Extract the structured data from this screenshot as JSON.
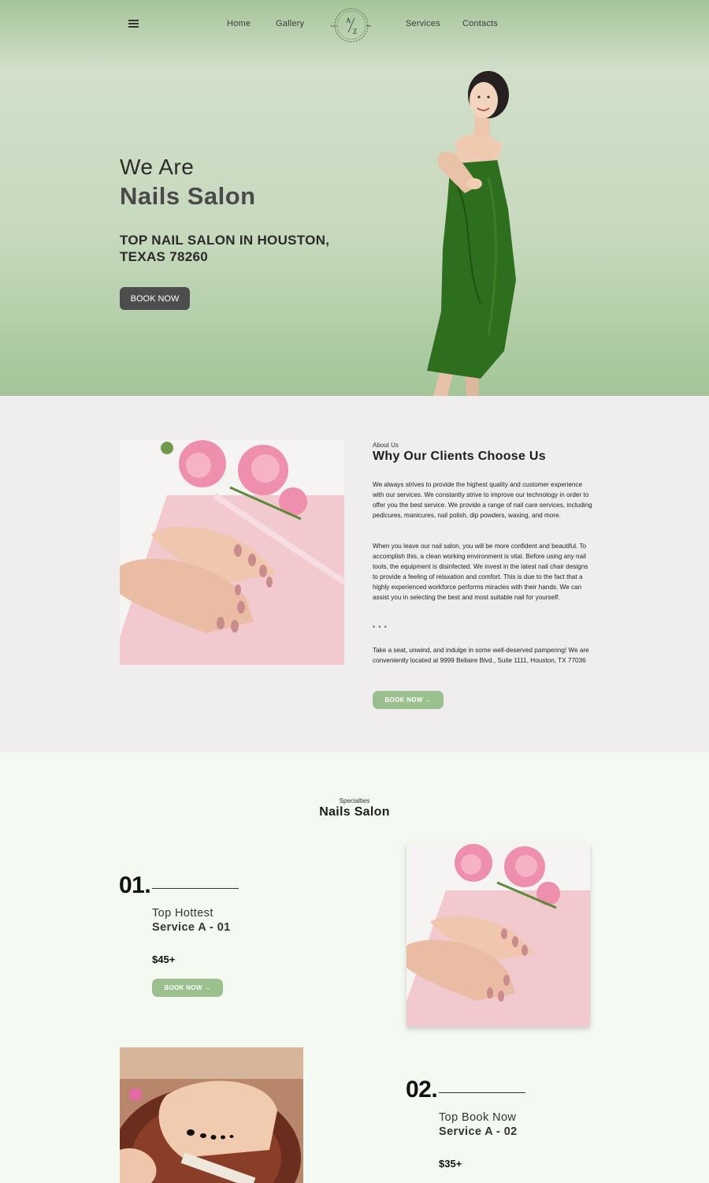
{
  "nav": {
    "links": [
      "Home",
      "Gallery",
      "Services",
      "Contacts"
    ],
    "logo": {
      "letters": [
        "A",
        "Z"
      ],
      "small_left": "NAILS",
      "small_right": "BAR"
    }
  },
  "hero": {
    "title_line1": "We Are",
    "title_line2": "Nails Salon",
    "subtitle": "TOP NAIL SALON IN HOUSTON, TEXAS 78260",
    "button": "BOOK NOW"
  },
  "about": {
    "eyebrow": "About Us",
    "title": "Why Our Clients Choose Us",
    "paragraph1": "We always strives to provide the highest quality and customer experience with our services. We constantly strive to improve our technology in order to offer you the best service. We provide a range of nail care services, including pedicures, manicures, nail polish, dip powders, waxing, and more.",
    "paragraph2": "When you leave our nail salon, you will be more confident and beautiful. To accomplish this, a clean working environment is vital. Before using any nail tools, the equipment is disinfected. We invest in the latest nail chair designs to provide a feeling of relaxation and comfort. This is due to the fact that a highly experienced workforce performs miracles with their hands. We can assist you in selecting the best and most suitable nail for yourself.",
    "separator": "* * *",
    "paragraph3_intro": "Take a seat, unwind, and indulge in some well-deserved pampering! We are conveniently located at ",
    "paragraph3_address": "9999 Bellaire Blvd., Suite 1111,",
    "paragraph3_city": " Houston, TX 77036",
    "button": "BOOK NOW →"
  },
  "specialties": {
    "eyebrow": "Specialties",
    "title": "Nails Salon",
    "items": [
      {
        "number": "01.",
        "line1": "Top Hottest",
        "line2": "Service A - 01",
        "price": "$45+",
        "button": "BOOK NOW →"
      },
      {
        "number": "02.",
        "line1": "Top Book Now",
        "line2": "Service A - 02",
        "price": "$35+"
      }
    ]
  },
  "colors": {
    "hero_green": "#c6d9bd",
    "about_bg": "#efeded",
    "button_green": "#9cbf8e",
    "button_dark": "#4d4d4d",
    "dress_green": "#2e6e1f"
  },
  "icons": [
    "hamburger-menu-icon",
    "arrow-right-icon",
    "logo-wreath-icon"
  ]
}
